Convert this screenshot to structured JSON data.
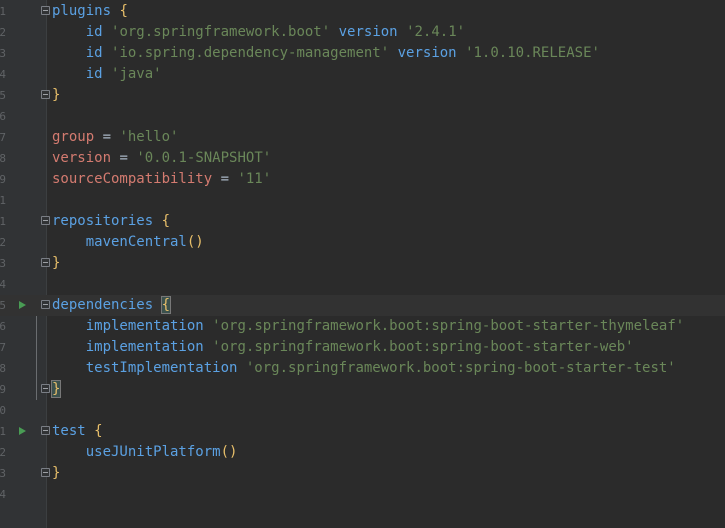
{
  "editor": {
    "lines": [
      {
        "n": "1",
        "parts": [
          {
            "c": "fn",
            "t": "plugins"
          },
          {
            "c": "",
            "t": " "
          },
          {
            "c": "brace",
            "t": "{"
          }
        ],
        "fold": true
      },
      {
        "n": "2",
        "parts": [
          {
            "c": "",
            "t": "    "
          },
          {
            "c": "fn",
            "t": "id"
          },
          {
            "c": "",
            "t": " "
          },
          {
            "c": "str",
            "t": "'org.springframework.boot'"
          },
          {
            "c": "",
            "t": " "
          },
          {
            "c": "fn",
            "t": "version"
          },
          {
            "c": "",
            "t": " "
          },
          {
            "c": "str",
            "t": "'2.4.1'"
          }
        ]
      },
      {
        "n": "3",
        "parts": [
          {
            "c": "",
            "t": "    "
          },
          {
            "c": "fn",
            "t": "id"
          },
          {
            "c": "",
            "t": " "
          },
          {
            "c": "str",
            "t": "'io.spring.dependency-management'"
          },
          {
            "c": "",
            "t": " "
          },
          {
            "c": "fn",
            "t": "version"
          },
          {
            "c": "",
            "t": " "
          },
          {
            "c": "str",
            "t": "'1.0.10.RELEASE'"
          }
        ]
      },
      {
        "n": "4",
        "parts": [
          {
            "c": "",
            "t": "    "
          },
          {
            "c": "fn",
            "t": "id"
          },
          {
            "c": "",
            "t": " "
          },
          {
            "c": "str",
            "t": "'java'"
          }
        ]
      },
      {
        "n": "5",
        "parts": [
          {
            "c": "brace",
            "t": "}"
          }
        ],
        "fold": true
      },
      {
        "n": "6",
        "parts": []
      },
      {
        "n": "7",
        "parts": [
          {
            "c": "var",
            "t": "group"
          },
          {
            "c": "",
            "t": " = "
          },
          {
            "c": "str",
            "t": "'hello'"
          }
        ]
      },
      {
        "n": "8",
        "parts": [
          {
            "c": "var",
            "t": "version"
          },
          {
            "c": "",
            "t": " = "
          },
          {
            "c": "str",
            "t": "'0.0.1-SNAPSHOT'"
          }
        ]
      },
      {
        "n": "9",
        "parts": [
          {
            "c": "var",
            "t": "sourceCompatibility"
          },
          {
            "c": "",
            "t": " = "
          },
          {
            "c": "str",
            "t": "'11'"
          }
        ]
      },
      {
        "n": "1",
        "parts": []
      },
      {
        "n": "1",
        "parts": [
          {
            "c": "fn",
            "t": "repositories"
          },
          {
            "c": "",
            "t": " "
          },
          {
            "c": "brace",
            "t": "{"
          }
        ],
        "fold": true
      },
      {
        "n": "2",
        "parts": [
          {
            "c": "",
            "t": "    "
          },
          {
            "c": "fn",
            "t": "mavenCentral"
          },
          {
            "c": "brace",
            "t": "()"
          }
        ]
      },
      {
        "n": "3",
        "parts": [
          {
            "c": "brace",
            "t": "}"
          }
        ],
        "fold": true
      },
      {
        "n": "4",
        "parts": []
      },
      {
        "n": "5",
        "parts": [
          {
            "c": "fn",
            "t": "dependencies"
          },
          {
            "c": "",
            "t": " "
          },
          {
            "c": "brace match",
            "t": "{"
          }
        ],
        "fold": true,
        "run": true,
        "current": true
      },
      {
        "n": "6",
        "parts": [
          {
            "c": "",
            "t": "    "
          },
          {
            "c": "fn",
            "t": "implementation"
          },
          {
            "c": "",
            "t": " "
          },
          {
            "c": "str",
            "t": "'org.springframework.boot:spring-boot-starter-thymeleaf'"
          }
        ]
      },
      {
        "n": "7",
        "parts": [
          {
            "c": "",
            "t": "    "
          },
          {
            "c": "fn",
            "t": "implementation"
          },
          {
            "c": "",
            "t": " "
          },
          {
            "c": "str",
            "t": "'org.springframework.boot:spring-boot-starter-web'"
          }
        ]
      },
      {
        "n": "8",
        "parts": [
          {
            "c": "",
            "t": "    "
          },
          {
            "c": "fn",
            "t": "testImplementation"
          },
          {
            "c": "",
            "t": " "
          },
          {
            "c": "str",
            "t": "'org.springframework.boot:spring-boot-starter-test'"
          }
        ]
      },
      {
        "n": "9",
        "parts": [
          {
            "c": "brace match-close",
            "t": "}"
          }
        ],
        "fold": true
      },
      {
        "n": "0",
        "parts": []
      },
      {
        "n": "1",
        "parts": [
          {
            "c": "fn",
            "t": "test"
          },
          {
            "c": "",
            "t": " "
          },
          {
            "c": "brace",
            "t": "{"
          }
        ],
        "fold": true,
        "run": true
      },
      {
        "n": "2",
        "parts": [
          {
            "c": "",
            "t": "    "
          },
          {
            "c": "fn",
            "t": "useJUnitPlatform"
          },
          {
            "c": "brace",
            "t": "()"
          }
        ]
      },
      {
        "n": "3",
        "parts": [
          {
            "c": "brace",
            "t": "}"
          }
        ],
        "fold": true
      },
      {
        "n": "4",
        "parts": []
      }
    ]
  },
  "icons": {
    "run": "run-gutter-icon",
    "fold": "fold-toggle-icon"
  },
  "colors": {
    "background": "#2b2b2b",
    "gutter": "#313335",
    "string": "#6a8759",
    "keyword_fn": "#5ba1e3",
    "variable": "#d47b70",
    "brace": "#e8bf6a",
    "run": "#499c54"
  }
}
